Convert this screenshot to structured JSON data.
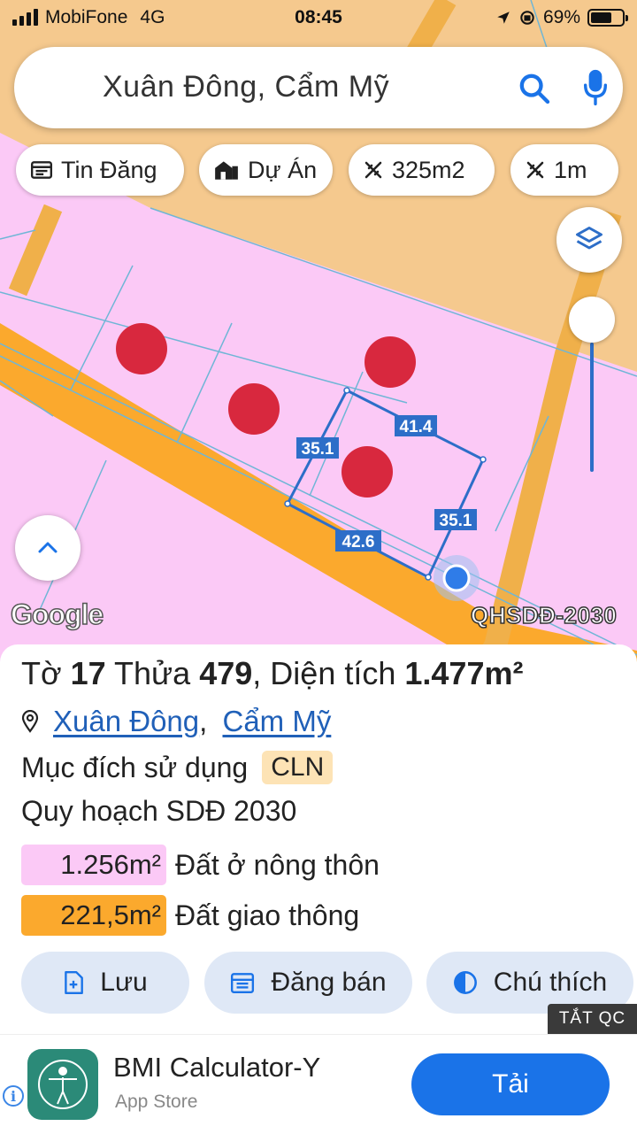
{
  "status_bar": {
    "carrier": "MobiFone",
    "network": "4G",
    "time": "08:45",
    "battery": "69%"
  },
  "search": {
    "query": "Xuân Đông, Cẩm Mỹ"
  },
  "chips": [
    {
      "label": "Tin Đăng",
      "icon": "listing-icon"
    },
    {
      "label": "Dự Án",
      "icon": "building-icon"
    },
    {
      "label": "325m2",
      "icon": "measure-icon"
    },
    {
      "label": "1m",
      "icon": "measure-icon"
    }
  ],
  "map": {
    "edge_labels": [
      "35.1",
      "41.4",
      "35.1",
      "42.6"
    ],
    "attribution": "Google",
    "layer_label": "QHSDĐ-2030",
    "colors": {
      "residential_rural": "#fbc9f6",
      "transport": "#fba92d",
      "perennial": "#f5c98e",
      "marker": "#d8283e",
      "boundary": "#2d6ec8"
    }
  },
  "parcel": {
    "sheet_label": "Tờ",
    "sheet_no": "17",
    "plot_label": "Thửa",
    "plot_no": "479",
    "area_label": "Diện tích",
    "area": "1.477m²",
    "location_parts": [
      "Xuân Đông",
      "Cẩm Mỹ"
    ],
    "location_sep": ",",
    "purpose_label": "Mục đích sử dụng",
    "purpose_code": "CLN",
    "plan_title": "Quy hoạch SDĐ 2030",
    "zones": [
      {
        "area": "1.256m²",
        "name": "Đất ở nông thôn"
      },
      {
        "area": "221,5m²",
        "name": "Đất giao thông"
      }
    ]
  },
  "actions": [
    {
      "label": "Lưu",
      "icon": "save-file-icon"
    },
    {
      "label": "Đăng bán",
      "icon": "calendar-icon"
    },
    {
      "label": "Chú thích",
      "icon": "contrast-icon"
    }
  ],
  "ad": {
    "close_tag": "TẮT QC",
    "app_name": "BMI Calculator-Y",
    "store": "App Store",
    "cta": "Tải"
  }
}
